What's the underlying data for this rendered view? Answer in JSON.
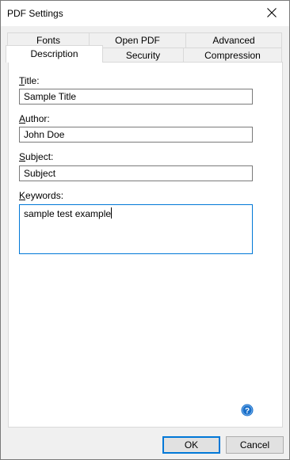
{
  "window": {
    "title": "PDF Settings"
  },
  "tabs": {
    "row_back": [
      {
        "label": "Fonts"
      },
      {
        "label": "Open PDF"
      },
      {
        "label": "Advanced"
      }
    ],
    "row_front": [
      {
        "label": "Description",
        "active": true
      },
      {
        "label": "Security",
        "active": false
      },
      {
        "label": "Compression",
        "active": false
      }
    ]
  },
  "description": {
    "title": {
      "mnemonic": "T",
      "label_rest": "itle:",
      "value": "Sample Title"
    },
    "author": {
      "mnemonic": "A",
      "label_rest": "uthor:",
      "value": "John Doe"
    },
    "subject": {
      "mnemonic": "S",
      "label_rest": "ubject:",
      "value": "Subject"
    },
    "keywords": {
      "mnemonic": "K",
      "label_rest": "eywords:",
      "value": "sample test example"
    }
  },
  "buttons": {
    "ok_label": "OK",
    "cancel_label": "Cancel"
  },
  "colors": {
    "accent": "#0078d7",
    "help_icon": "#1a6fc9"
  },
  "icons": {
    "close": "close-icon",
    "help": "help-icon"
  }
}
